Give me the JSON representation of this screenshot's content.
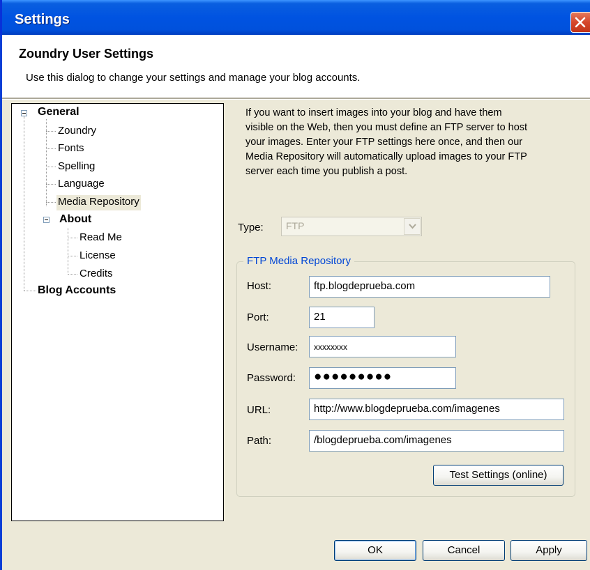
{
  "window": {
    "title": "Settings"
  },
  "header": {
    "title": "Zoundry User Settings",
    "subtitle": "Use this dialog to change your settings and manage your blog accounts."
  },
  "tree": {
    "general": "General",
    "general_items": [
      "Zoundry",
      "Fonts",
      "Spelling",
      "Language",
      "Media Repository"
    ],
    "about": "About",
    "about_items": [
      "Read Me",
      "License",
      "Credits"
    ],
    "blog_accounts": "Blog Accounts",
    "selected": "Media Repository"
  },
  "panel": {
    "description": [
      "If you want to insert images into your blog and have them",
      "visible on the Web, then you must define an FTP server to host",
      "your images.  Enter your FTP settings here once, and then our",
      "Media Repository will automatically upload images to your FTP",
      "server each time you publish a post."
    ],
    "type_label": "Type:",
    "type_value": "FTP",
    "group_title": "FTP Media Repository",
    "host_label": "Host:",
    "host_value": "ftp.blogdeprueba.com",
    "port_label": "Port:",
    "port_value": "21",
    "username_label": "Username:",
    "username_value": "xxxxxxxx",
    "password_label": "Password:",
    "password_value": "●●●●●●●●●",
    "url_label": "URL:",
    "url_value": "http://www.blogdeprueba.com/imagenes",
    "path_label": "Path:",
    "path_value": "/blogdeprueba.com/imagenes",
    "test_button": "Test Settings (online)"
  },
  "footer": {
    "ok": "OK",
    "cancel": "Cancel",
    "apply": "Apply"
  },
  "colors": {
    "titlebar": "#0053e1",
    "dialog_bg": "#ece9d8",
    "group_title": "#0046d5",
    "close": "#d6462b"
  }
}
